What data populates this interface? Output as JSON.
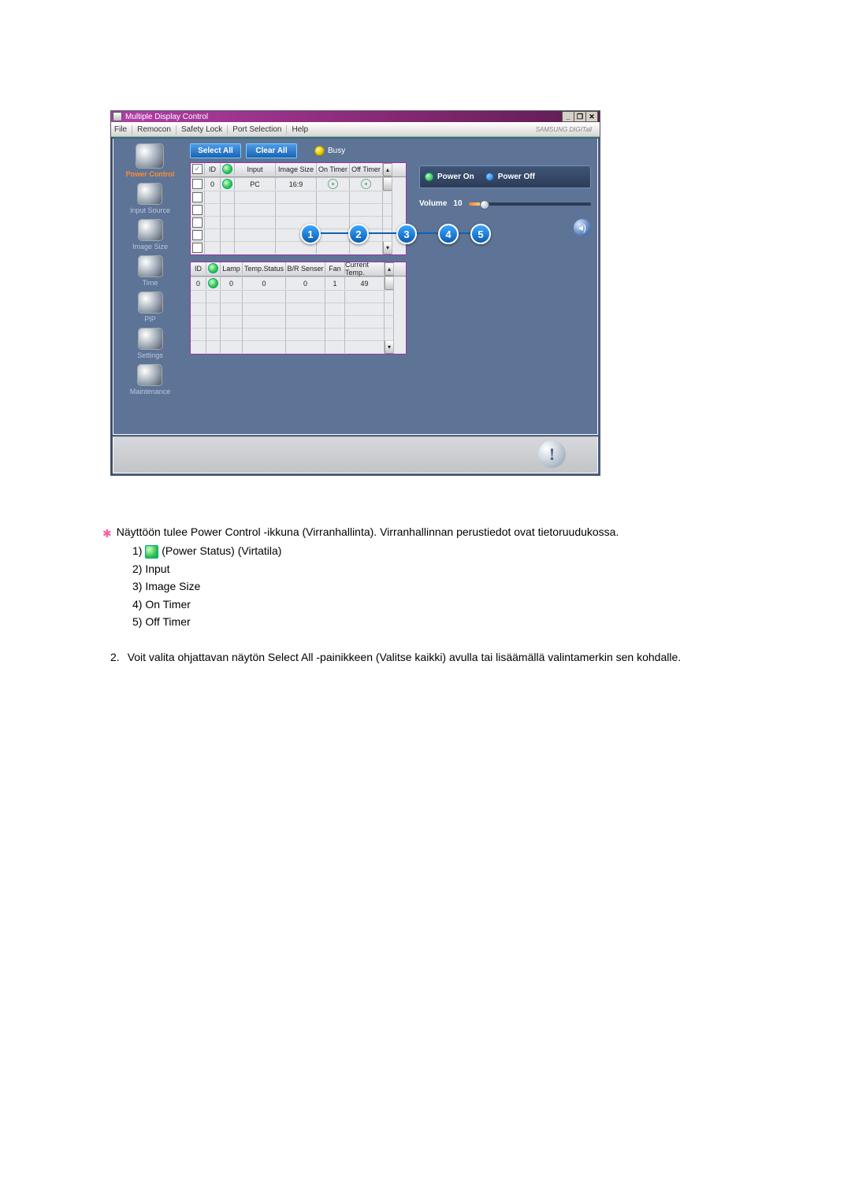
{
  "doc": {
    "lead": "Näyttöön tulee Power Control -ikkuna (Virranhallinta). Virranhallinnan perustiedot ovat tietoruudukossa.",
    "list": {
      "i1_before": "1)",
      "i1_after": "(Power Status) (Virtatila)",
      "i2": "2) Input",
      "i3": "3) Image Size",
      "i4": "4) On Timer",
      "i5": "5) Off Timer"
    },
    "para2_pre": "2.",
    "para2": "Voit valita ohjattavan näytön Select All -painikkeen (Valitse kaikki) avulla tai lisäämällä valintamerkin sen kohdalle."
  },
  "app": {
    "title": "Multiple Display Control",
    "brand": "SAMSUNG DIGITall",
    "menu": {
      "file": "File",
      "remocon": "Remocon",
      "safety": "Safety Lock",
      "port": "Port Selection",
      "help": "Help"
    },
    "sidebar": {
      "items": [
        {
          "label": "Power Control"
        },
        {
          "label": "Input Source"
        },
        {
          "label": "Image Size"
        },
        {
          "label": "Time"
        },
        {
          "label": "PIP"
        },
        {
          "label": "Settings"
        },
        {
          "label": "Maintenance"
        }
      ]
    },
    "toolbar": {
      "select_all": "Select All",
      "clear_all": "Clear All",
      "busy": "Busy"
    },
    "power": {
      "on": "Power On",
      "off": "Power Off"
    },
    "volume": {
      "label": "Volume",
      "value": "10"
    },
    "grid1": {
      "head": {
        "chk": "",
        "id": "ID",
        "ps": "",
        "input": "Input",
        "imgsize": "Image Size",
        "ontimer": "On Timer",
        "offtimer": "Off Timer"
      },
      "rows": [
        {
          "id": "0",
          "input": "PC",
          "imgsize": "16:9"
        }
      ]
    },
    "grid2": {
      "head": {
        "id": "ID",
        "ps": "",
        "lamp": "Lamp",
        "temp": "Temp.Status",
        "br": "B/R Senser",
        "fan": "Fan",
        "cur": "Current Temp."
      },
      "rows": [
        {
          "id": "0",
          "lamp": "0",
          "temp": "0",
          "br": "0",
          "fan": "1",
          "cur": "49"
        }
      ]
    },
    "markers": [
      "1",
      "2",
      "3",
      "4",
      "5"
    ]
  }
}
